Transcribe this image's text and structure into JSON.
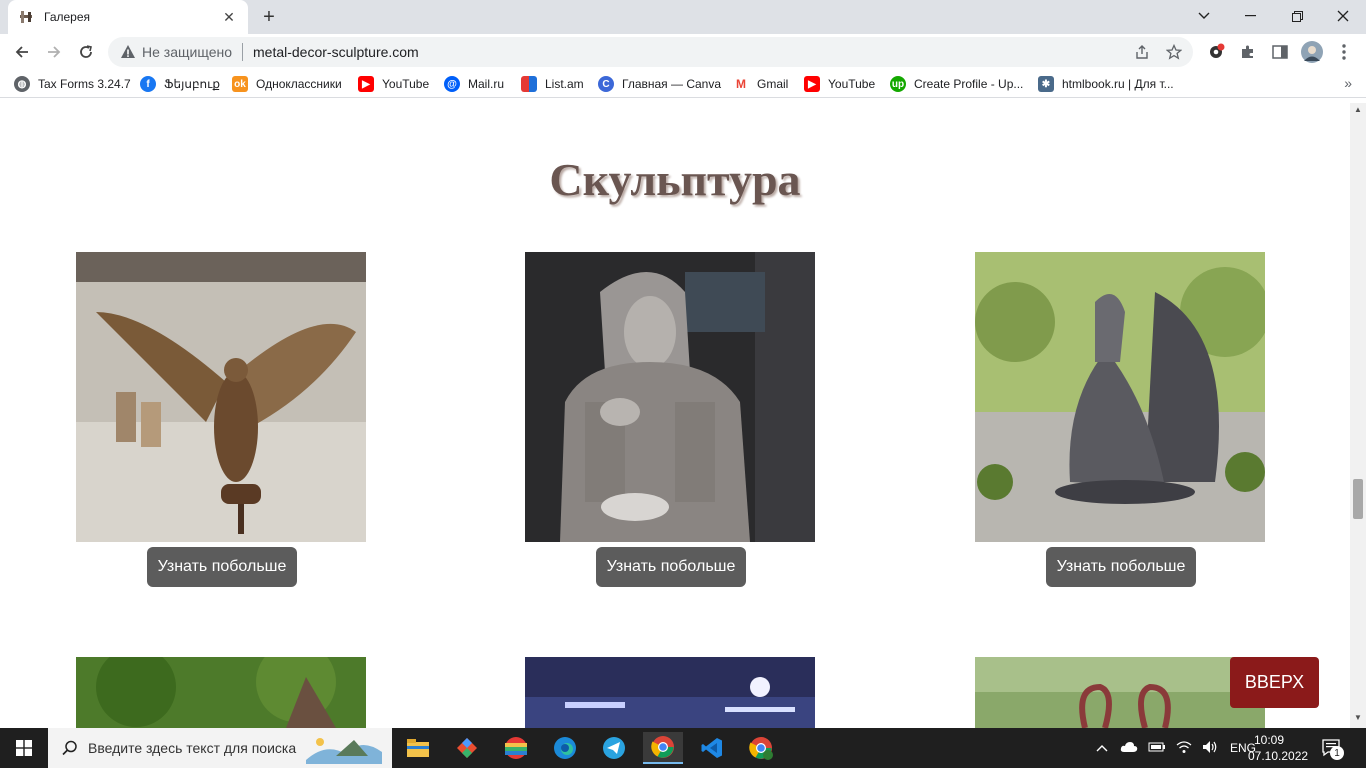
{
  "browser": {
    "tab_title": "Галерея",
    "tab_close": "✕",
    "new_tab": "+",
    "not_secure": "Не защищено",
    "url": "metal-decor-sculpture.com"
  },
  "bookmarks": [
    {
      "label": "Tax Forms 3.24.7",
      "icon": "globe-icon",
      "color": "#5f6368"
    },
    {
      "label": "Ֆեյսբուք",
      "icon": "facebook-icon",
      "color": "#1877f2"
    },
    {
      "label": "Одноклассники",
      "icon": "odnoklassniki-icon",
      "color": "#f7931e"
    },
    {
      "label": "YouTube",
      "icon": "youtube-icon",
      "color": "#ff0000"
    },
    {
      "label": "Mail.ru",
      "icon": "mailru-icon",
      "color": "#005ff9"
    },
    {
      "label": "List.am",
      "icon": "listam-icon",
      "color": "#2b6fd8"
    },
    {
      "label": "Главная — Canva",
      "icon": "canva-icon",
      "color": "#3c68d8"
    },
    {
      "label": "Gmail",
      "icon": "gmail-icon",
      "color": "#ea4335"
    },
    {
      "label": "YouTube",
      "icon": "youtube-icon",
      "color": "#ff0000"
    },
    {
      "label": "Create Profile - Up...",
      "icon": "upwork-icon",
      "color": "#14a800"
    },
    {
      "label": "htmlbook.ru | Для т...",
      "icon": "htmlbook-icon",
      "color": "#4a6a8a"
    }
  ],
  "page": {
    "title": "Скульптура",
    "gallery": [
      {
        "button": "Узнать побольше",
        "photo": "eagle-sculpture"
      },
      {
        "button": "Узнать побольше",
        "photo": "hooded-figure-sculpture"
      },
      {
        "button": "Узнать побольше",
        "photo": "dragon-sculpture"
      }
    ],
    "up_button": "ВВЕРХ"
  },
  "taskbar": {
    "search_placeholder": "Введите здесь текст для поиска",
    "lang": "ENG",
    "time": "10:09",
    "date": "07.10.2022",
    "notifications": "1"
  },
  "colors": {
    "title": "#6a5651",
    "button": "#5c5c5c",
    "up_button": "#8b1a1a"
  }
}
